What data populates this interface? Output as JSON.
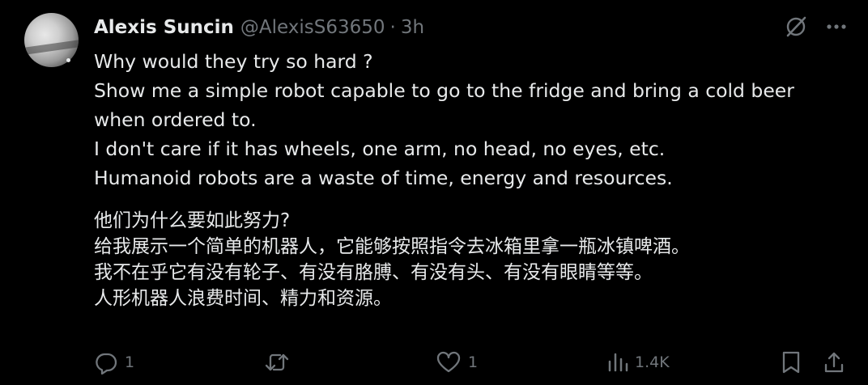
{
  "tweet": {
    "author_name": "Alexis Suncin",
    "handle": "@AlexisS63650",
    "separator": "·",
    "time": "3h",
    "text_en": [
      "Why would they try so hard ?",
      "Show me a simple robot capable to go to the fridge and bring a cold beer",
      "when ordered to.",
      "I don't care if it has wheels, one arm, no head, no eyes, etc.",
      "Humanoid robots are a waste of time, energy and resources."
    ],
    "text_cn": [
      "他们为什么要如此努力?",
      "给我展示一个简单的机器人，它能够按照指令去冰箱里拿一瓶冰镇啤酒。",
      "我不在乎它有没有轮子、有没有胳膊、有没有头、有没有眼睛等等。",
      "人形机器人浪费时间、精力和资源。"
    ]
  },
  "actions": {
    "reply_count": "1",
    "repost_count": "",
    "like_count": "1",
    "views_count": "1.4K"
  },
  "icons": {
    "top": [
      "grok-slash-icon",
      "more-icon"
    ],
    "bottom": [
      "reply-icon",
      "repost-icon",
      "like-icon",
      "views-icon",
      "bookmark-icon",
      "share-icon"
    ]
  },
  "colors": {
    "background": "#000000",
    "text": "#e7e9ea",
    "muted": "#71767b"
  }
}
